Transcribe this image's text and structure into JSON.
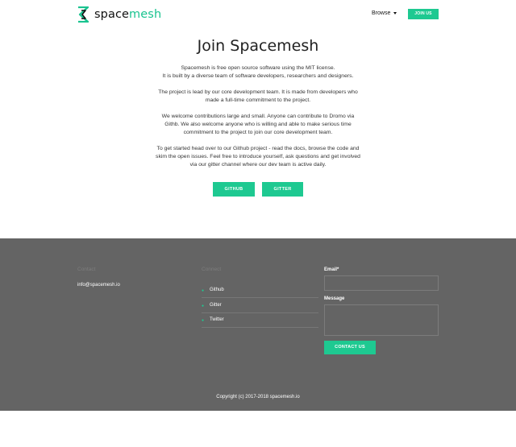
{
  "header": {
    "logo_prefix": "space",
    "logo_suffix": "mesh",
    "browse_label": "Browse",
    "join_label": "JOIN US"
  },
  "main": {
    "title": "Join Spacemesh",
    "paragraphs": [
      [
        "Spacemesh is free open source software using the MIT license.",
        "It is built by a diverse team of software developers, researchers and designers."
      ],
      [
        "The project is lead by our core development team. It is made from developers who",
        "made a full-time commitment to the project."
      ],
      [
        "We welcome contributions large and small.  Anyone can contribute to Dromo via",
        "Githb. We also welcome anyone who is willing and able to make serious time",
        "commitment to the project to join our core development team."
      ],
      [
        "To get started head over to our Github project - read the docs, browse the code and",
        "skim the open issues. Feel free to introduce yourself, ask questions and get involved",
        "via our gitter channel where our dev team is active daily."
      ]
    ],
    "github_button": "GITHUB",
    "gitter_button": "GITTER"
  },
  "footer": {
    "contact_heading": "Contact",
    "connect_heading": "Connect",
    "email": "info@spacemesh.io",
    "links": [
      "Github",
      "Gitter",
      "Twitter"
    ],
    "email_label": "Email*",
    "message_label": "Message",
    "submit_label": "CONTACT US",
    "copyright": "Copyright (c) 2017-2018 spacemesh.io"
  },
  "colors": {
    "accent": "#1ec991",
    "footer_bg": "#646464"
  }
}
